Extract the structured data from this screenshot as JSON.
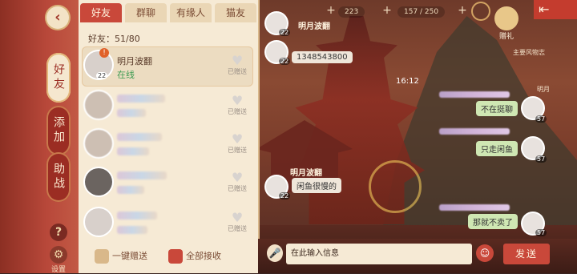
{
  "side_tabs": [
    {
      "label": "好友",
      "active": true
    },
    {
      "label": "添加",
      "active": false
    },
    {
      "label": "助战",
      "active": false
    }
  ],
  "settings_label": "设置",
  "help_label": "?",
  "tabs": [
    "好友",
    "群聊",
    "有缘人",
    "猫友"
  ],
  "friend_count": "好友：51/80",
  "friends": [
    {
      "name": "明月波翻",
      "status": "在线",
      "level": "22",
      "gift": "已赠送",
      "badge": "!"
    },
    {
      "name": "",
      "status": "",
      "level": "",
      "gift": "已赠送"
    },
    {
      "name": "",
      "status": "",
      "level": "",
      "gift": "已赠送"
    },
    {
      "name": "",
      "status": "",
      "level": "",
      "gift": "已赠送"
    },
    {
      "name": "",
      "status": "",
      "level": "",
      "gift": "已赠送"
    }
  ],
  "bottom_buttons": {
    "send_all": "一键赠送",
    "receive_all": "全部接收"
  },
  "topbar": {
    "res1": "223",
    "res2": "157 / 250"
  },
  "gift_label": "赠礼",
  "chat": {
    "partner_name": "明月波翻",
    "partner_level": "22",
    "time": "16:12",
    "messages_left": [
      {
        "text": "1348543800"
      },
      {
        "text": "闲鱼很慢的"
      }
    ],
    "messages_right": [
      {
        "text": "不在挺聊",
        "level": "57"
      },
      {
        "text": "只走闲鱼",
        "level": "57"
      },
      {
        "text": "那就不卖了",
        "level": "57"
      }
    ]
  },
  "side_names": [
    "主要风物志",
    "明月"
  ],
  "input_placeholder": "在此输入信息",
  "send_label": "发送"
}
